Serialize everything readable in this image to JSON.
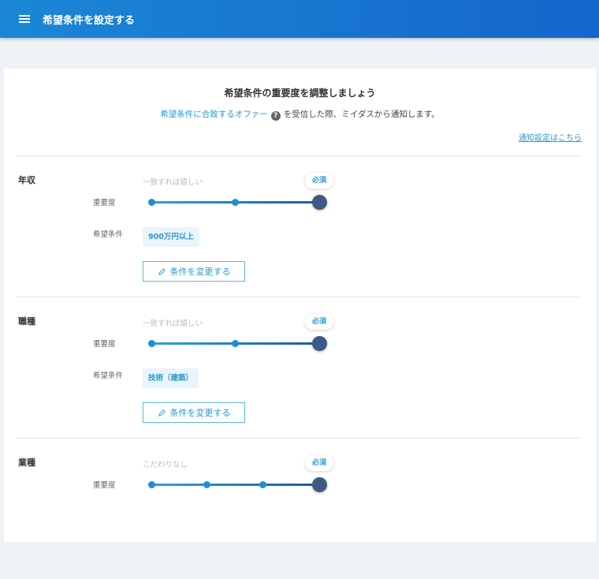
{
  "header": {
    "title": "希望条件を設定する"
  },
  "intro": {
    "title": "希望条件の重要度を調整しましょう",
    "link": "希望条件に合致するオファー",
    "help": "?",
    "rest": "を受信した際、ミイダスから通知します。",
    "notify_link": "通知設定はこちら"
  },
  "labels": {
    "importance": "重要度",
    "condition": "希望条件",
    "change_button": "条件を変更する",
    "required": "必須"
  },
  "sections": [
    {
      "title": "年収",
      "top_label": "一致すれば嬉しい",
      "stops": 3,
      "value": 3,
      "condition": "900万円以上"
    },
    {
      "title": "職種",
      "top_label": "一致すれば嬉しい",
      "stops": 3,
      "value": 3,
      "condition": "技術（建築）"
    },
    {
      "title": "業種",
      "top_label": "こだわりなし",
      "stops": 4,
      "value": 4
    }
  ]
}
